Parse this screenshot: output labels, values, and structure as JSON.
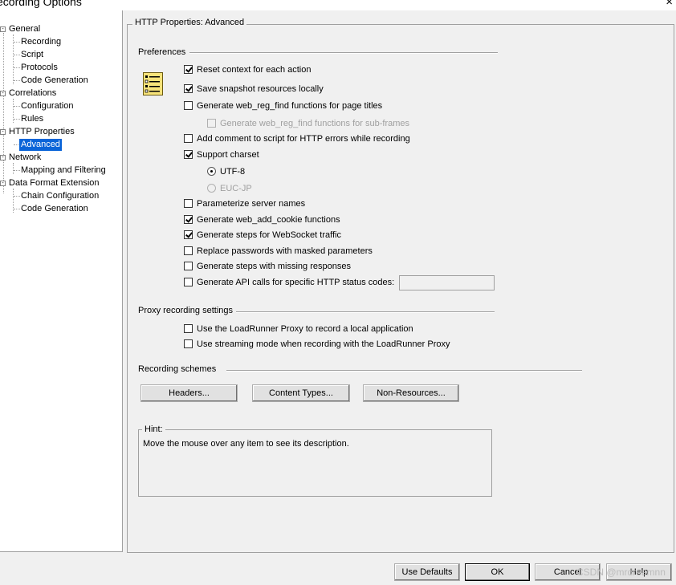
{
  "window": {
    "title": "ecording Options",
    "close_glyph": "×"
  },
  "tree": [
    {
      "label": "General",
      "level": 0,
      "expander": "-"
    },
    {
      "label": "Recording",
      "level": 1
    },
    {
      "label": "Script",
      "level": 1
    },
    {
      "label": "Protocols",
      "level": 1
    },
    {
      "label": "Code Generation",
      "level": 1
    },
    {
      "label": "Correlations",
      "level": 0,
      "expander": "-"
    },
    {
      "label": "Configuration",
      "level": 1
    },
    {
      "label": "Rules",
      "level": 1
    },
    {
      "label": "HTTP Properties",
      "level": 0,
      "expander": "-"
    },
    {
      "label": "Advanced",
      "level": 1,
      "selected": true
    },
    {
      "label": "Network",
      "level": 0,
      "expander": "-"
    },
    {
      "label": "Mapping and Filtering",
      "level": 1
    },
    {
      "label": "Data Format Extension",
      "level": 0,
      "expander": "-"
    },
    {
      "label": "Chain Configuration",
      "level": 1
    },
    {
      "label": "Code Generation",
      "level": 1
    }
  ],
  "panel": {
    "title": "HTTP Properties: Advanced",
    "preferences": {
      "heading": "Preferences",
      "icon": "settings-list-icon",
      "options": [
        {
          "label": "Reset context for each action",
          "checked": true
        },
        {
          "label": "Save snapshot resources locally",
          "checked": true
        },
        {
          "label": "Generate web_reg_find functions for page titles",
          "checked": false
        },
        {
          "label": "Generate web_reg_find functions for sub-frames",
          "checked": false,
          "disabled": true
        },
        {
          "label": "Add comment to script for HTTP errors while recording",
          "checked": false
        },
        {
          "label": "Support charset",
          "checked": true
        },
        {
          "label": "Parameterize server names",
          "checked": false
        },
        {
          "label": "Generate web_add_cookie functions",
          "checked": true
        },
        {
          "label": "Generate steps for WebSocket traffic",
          "checked": true
        },
        {
          "label": "Replace passwords with masked parameters",
          "checked": false
        },
        {
          "label": "Generate steps with missing responses",
          "checked": false
        },
        {
          "label": "Generate API calls for specific HTTP status codes:",
          "checked": false
        }
      ],
      "charsets": [
        {
          "label": "UTF-8",
          "selected": true
        },
        {
          "label": "EUC-JP",
          "selected": false,
          "disabled": true
        }
      ],
      "status_codes_value": ""
    },
    "proxy": {
      "heading": "Proxy recording settings",
      "options": [
        {
          "label": "Use the LoadRunner Proxy to record a local application",
          "checked": false
        },
        {
          "label": "Use streaming mode when recording with the LoadRunner Proxy",
          "checked": false
        }
      ]
    },
    "schemes": {
      "heading": "Recording schemes",
      "buttons": [
        "Headers...",
        "Content Types...",
        "Non-Resources..."
      ]
    },
    "hint": {
      "heading": "Hint:",
      "text": "Move the mouse over any item to see its description."
    }
  },
  "footer": {
    "buttons": [
      "Use Defaults",
      "OK",
      "Cancel",
      "Help"
    ]
  },
  "watermark": "CSDN @mrdreamnn"
}
